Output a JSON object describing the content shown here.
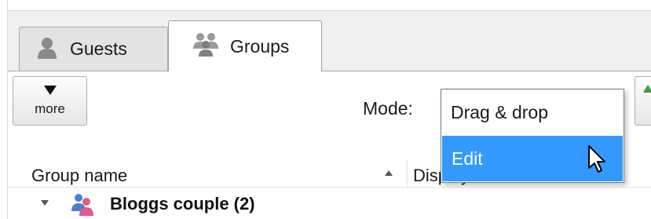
{
  "tabs": [
    {
      "label": "Guests",
      "icon": "person-icon",
      "active": false
    },
    {
      "label": "Groups",
      "icon": "people-group-icon",
      "active": true
    }
  ],
  "toolbar": {
    "more_label": "more",
    "mode_label": "Mode:",
    "mode_options": [
      "Drag & drop",
      "Edit"
    ],
    "mode_highlighted": "Edit"
  },
  "table": {
    "columns": [
      "Group name",
      "Display name"
    ],
    "sort": "ascending",
    "rows": [
      {
        "label": "Bloggs couple (2)",
        "expanded": true,
        "icon": "couple-icon"
      }
    ]
  },
  "colors": {
    "selection": "#3399ff",
    "tab_bg_inactive": "#e3e3e3",
    "window_bg": "#f0f0f0",
    "accent_green": "#3c9b3c"
  }
}
